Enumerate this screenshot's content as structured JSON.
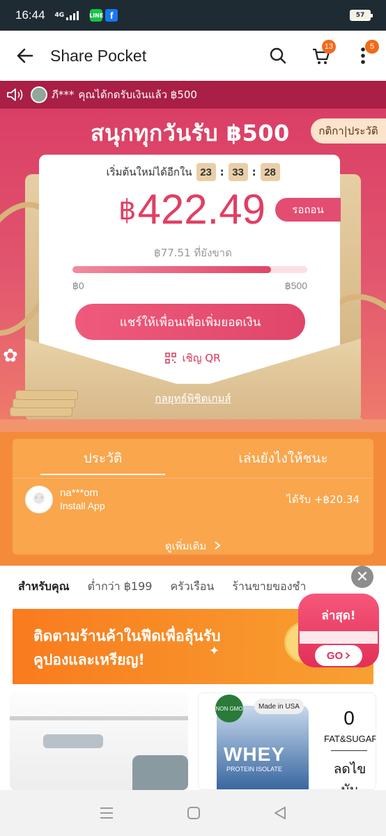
{
  "status_bar": {
    "time": "16:44",
    "network": "4G",
    "line_app": "LINE",
    "facebook_app": "f",
    "battery": "57"
  },
  "header": {
    "title": "Share Pocket",
    "cart_badge": "13",
    "menu_badge": "5"
  },
  "ticker": {
    "user": "ภี***",
    "text": "คุณได้กดรับเงินแล้ว ฿500"
  },
  "promo": {
    "headline": "สนุกทุกวันรับ ฿500",
    "rules_history_label": "กติกา|ประวัติ",
    "countdown_label": "เริ่มต้นใหม่ได้อีกใน",
    "countdown": {
      "hours": "23",
      "minutes": "33",
      "seconds": "28"
    },
    "currency": "฿",
    "amount": "422.49",
    "pending_label": "รอถอน",
    "remaining_text": "฿77.51 ที่ยังขาด",
    "progress_fraction": 0.845,
    "progress_min_label": "฿0",
    "progress_max_label": "฿500",
    "share_button": "แชร์ให้เพื่อนเพื่อเพิ่มยอดเงิน",
    "qr_label": "เชิญ QR",
    "strategy_link": "กลยุทธ์พิชิตเกมส์"
  },
  "history": {
    "tabs": [
      "ประวัติ",
      "เล่นยังไงให้ชนะ"
    ],
    "entries": [
      {
        "name": "na***om",
        "action": "Install App",
        "reward": "ได้รับ +฿20.34"
      }
    ],
    "see_more": "ดูเพิ่มเติม"
  },
  "categories": [
    "สำหรับคุณ",
    "ต่ำกว่า ฿199",
    "ครัวเรือน",
    "ร้านขายของชำ"
  ],
  "banner": {
    "text_line1": "ติดตามร้านค้าในฟีดเพื่อลุ้นรับ",
    "text_line2": "คูปองและเหรียญ!"
  },
  "latest_badge": {
    "title": "ล่าสุด!",
    "go": "GO"
  },
  "products": {
    "p2_badge_nongmo": "NON GMO",
    "p2_badge_usa": "Made in USA",
    "p2_title": "WHEY",
    "p2_sub": "PROTEIN ISOLATE",
    "p2_zero": "0",
    "p2_fatsugar": "FAT&SUGAR",
    "p2_desc": "ลดไขมัน"
  },
  "colors": {
    "brand_orange": "#f26a1b",
    "promo_red": "#d93a64",
    "accent_pink": "#e03f63",
    "history_orange": "#f48b3a"
  }
}
